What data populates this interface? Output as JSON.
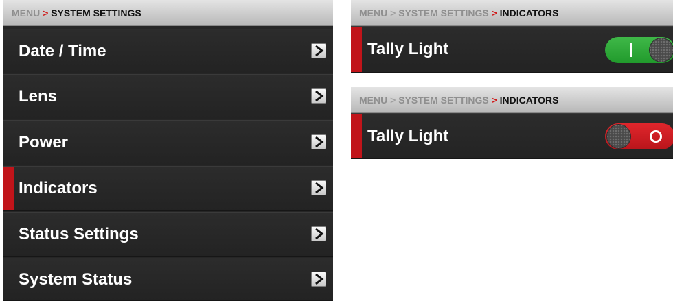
{
  "left_panel": {
    "breadcrumb": {
      "menu": "MENU",
      "separator": ">",
      "current": "SYSTEM SETTINGS"
    },
    "items": [
      {
        "label": "Date / Time"
      },
      {
        "label": "Lens"
      },
      {
        "label": "Power"
      },
      {
        "label": "Indicators",
        "selected": true
      },
      {
        "label": "Status Settings"
      },
      {
        "label": "System Status"
      }
    ]
  },
  "right_top": {
    "breadcrumb": {
      "menu": "MENU",
      "sep1": ">",
      "parent": "SYSTEM SETTINGS",
      "sep2": ">",
      "current": "INDICATORS"
    },
    "setting": {
      "label": "Tally Light",
      "state": "on"
    }
  },
  "right_bottom": {
    "breadcrumb": {
      "menu": "MENU",
      "sep1": ">",
      "parent": "SYSTEM SETTINGS",
      "sep2": ">",
      "current": "INDICATORS"
    },
    "setting": {
      "label": "Tally Light",
      "state": "off"
    }
  },
  "colors": {
    "accent": "#c1141a",
    "toggle_on": "#2ea83a",
    "toggle_off": "#cc1c22",
    "panel_bg": "#262626"
  },
  "icons": {
    "row_chevron": "chevron-right-icon",
    "toggle_knob": "toggle-knob-icon"
  }
}
